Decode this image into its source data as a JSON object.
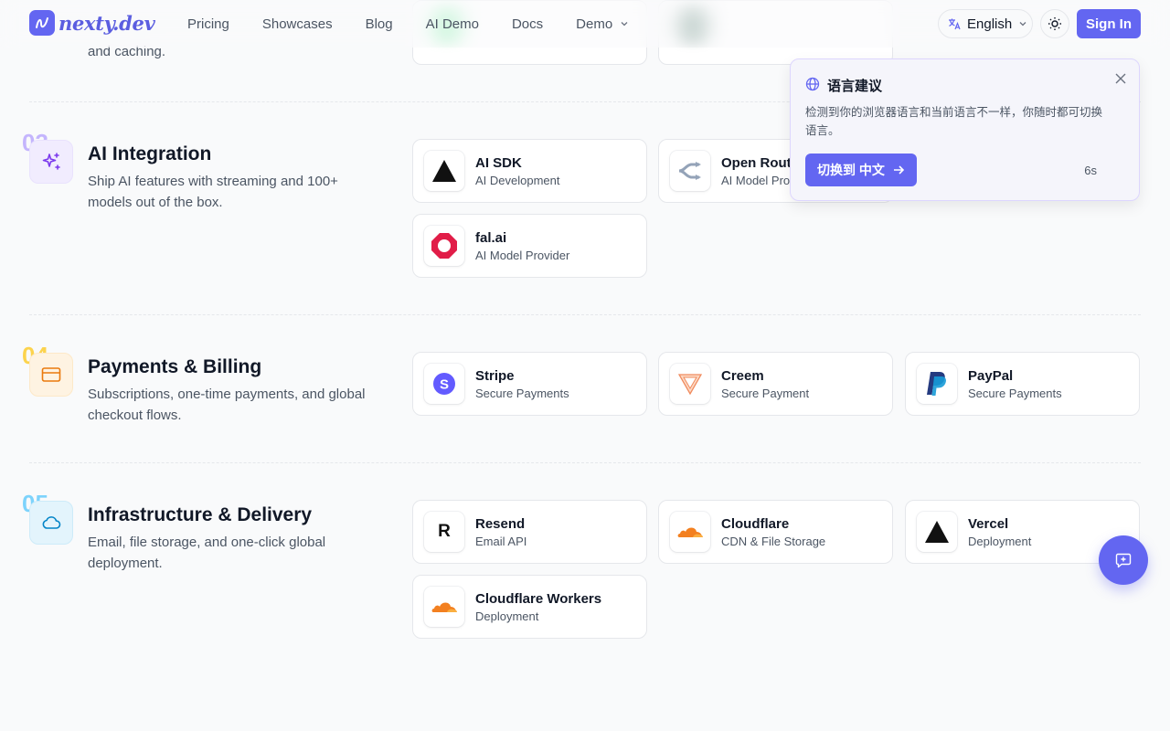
{
  "header": {
    "logo_text": "nexty.dev",
    "nav": [
      {
        "label": "Pricing"
      },
      {
        "label": "Showcases"
      },
      {
        "label": "Blog"
      },
      {
        "label": "AI Demo"
      },
      {
        "label": "Docs"
      },
      {
        "label": "Demo"
      }
    ],
    "language_label": "English",
    "signin_label": "Sign In"
  },
  "previous_section": {
    "desc_tail": "and caching."
  },
  "sections": [
    {
      "number": "03",
      "title": "AI Integration",
      "desc": "Ship AI features with streaming and 100+ models out of the box.",
      "icon": "sparkles-icon",
      "accent": "#a78bfa",
      "cards": [
        {
          "name": "AI SDK",
          "sub": "AI Development",
          "icon": "vercel-triangle-icon"
        },
        {
          "name": "Open Router",
          "sub": "AI Model Provider",
          "icon": "openrouter-icon"
        },
        {
          "name": "fal.ai",
          "sub": "AI Model Provider",
          "icon": "fal-icon"
        }
      ]
    },
    {
      "number": "04",
      "title": "Payments & Billing",
      "desc": "Subscriptions, one-time payments, and global checkout flows.",
      "icon": "credit-card-icon",
      "accent": "#fbbf24",
      "cards": [
        {
          "name": "Stripe",
          "sub": "Secure Payments",
          "icon": "stripe-icon"
        },
        {
          "name": "Creem",
          "sub": "Secure Payment",
          "icon": "creem-icon"
        },
        {
          "name": "PayPal",
          "sub": "Secure Payments",
          "icon": "paypal-icon"
        }
      ]
    },
    {
      "number": "05",
      "title": "Infrastructure & Delivery",
      "desc": "Email, file storage, and one-click global deployment.",
      "icon": "cloud-icon",
      "accent": "#38bdf8",
      "cards": [
        {
          "name": "Resend",
          "sub": "Email API",
          "icon": "resend-icon"
        },
        {
          "name": "Cloudflare",
          "sub": "CDN & File Storage",
          "icon": "cloudflare-icon"
        },
        {
          "name": "Vercel",
          "sub": "Deployment",
          "icon": "vercel-triangle-icon"
        },
        {
          "name": "Cloudflare Workers",
          "sub": "Deployment",
          "icon": "cloudflare-icon"
        }
      ]
    }
  ],
  "popup": {
    "title": "语言建议",
    "message": "检测到你的浏览器语言和当前语言不一样，你随时都可切换语言。",
    "button_label": "切换到 中文",
    "countdown": "6s"
  },
  "colors": {
    "primary": "#6366f1",
    "stripe": "#635bff",
    "fal": "#e11d48",
    "cloudflare": "#f38020",
    "paypal_dark": "#253b80",
    "paypal_light": "#179bd7"
  }
}
